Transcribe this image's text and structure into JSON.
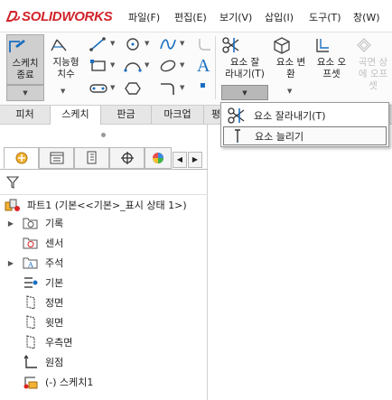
{
  "app": {
    "logo": "SOLIDWORKS"
  },
  "menu": [
    "파일(F)",
    "편집(E)",
    "보기(V)",
    "삽입(I)",
    "도구(T)",
    "창(W)"
  ],
  "ribbon": {
    "sketch_exit": {
      "line1": "스케치",
      "line2": "종료"
    },
    "smart_dim": {
      "line1": "지능형",
      "line2": "치수"
    },
    "trim": {
      "line1": "요소 잘",
      "line2": "라내기(T)"
    },
    "convert": {
      "line1": "요소 변",
      "line2": "환"
    },
    "offset": {
      "line1": "요소 오",
      "line2": "프셋"
    },
    "surface_offset": {
      "line1": "곡면 상",
      "line2": "에 오프",
      "line3": "셋"
    },
    "text_tool": "A"
  },
  "tabs": [
    "피처",
    "스케치",
    "판금",
    "마크업",
    "평"
  ],
  "dropdown": {
    "items": [
      "요소 잘라내기(T)",
      "요소 늘리기"
    ]
  },
  "panel": {
    "root": "파트1  (기본<<기본>_표시 상태 1>)",
    "items": [
      {
        "label": "기록",
        "expandable": true
      },
      {
        "label": "센서",
        "expandable": false
      },
      {
        "label": "주석",
        "expandable": true
      },
      {
        "label": "기본",
        "expandable": false
      },
      {
        "label": "정면",
        "expandable": false
      },
      {
        "label": "윗면",
        "expandable": false
      },
      {
        "label": "우측면",
        "expandable": false
      },
      {
        "label": "원점",
        "expandable": false
      },
      {
        "label": "(-) 스케치1",
        "expandable": false
      }
    ]
  },
  "colors": {
    "brand": "#d2232a",
    "accent": "#1a6fc0"
  }
}
